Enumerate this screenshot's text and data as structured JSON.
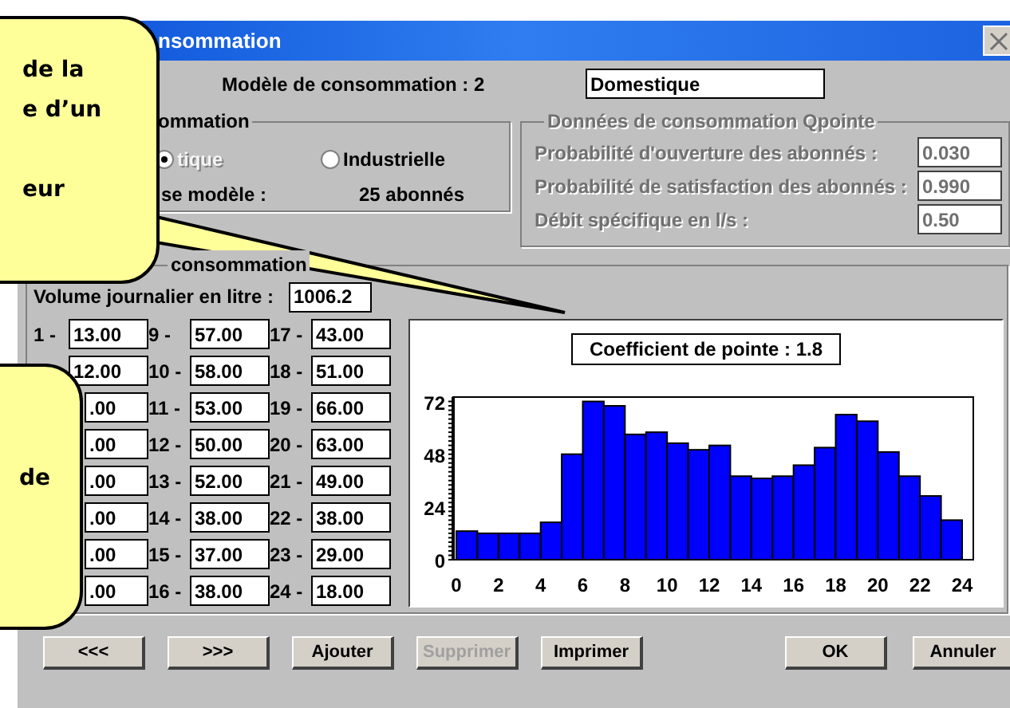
{
  "window": {
    "title": "nsommation"
  },
  "model": {
    "label": "Modèle de consommation : 2",
    "name": "Domestique"
  },
  "type_group": {
    "legend": "ommation",
    "options": [
      {
        "label": "tique",
        "selected": true,
        "disabled": true
      },
      {
        "label": "Industrielle",
        "selected": false,
        "disabled": false
      }
    ],
    "subscribers_label": "se modèle :",
    "subscribers_value": "25 abonnés"
  },
  "peak_group": {
    "legend": "Données de consommation Qpointe",
    "disabled": true,
    "fields": [
      {
        "label": "Probabilité d'ouverture des abonnés :",
        "value": "0.030"
      },
      {
        "label": "Probabilité de satisfaction des abonnés :",
        "value": "0.990"
      },
      {
        "label": "Débit spécifique en l/s :",
        "value": "0.50"
      }
    ]
  },
  "hourly_group": {
    "legend": "consommation",
    "volume_label": "Volume journalier en litre :",
    "volume": "1006.2",
    "hours": [
      {
        "label": "1 -",
        "value": "13.00"
      },
      {
        "value": "12.00"
      },
      {
        "value": ".00"
      },
      {
        "value": ".00"
      },
      {
        "value": ".00"
      },
      {
        "value": ".00"
      },
      {
        "value": ".00"
      },
      {
        "value": ".00"
      },
      {
        "label": "9 -",
        "value": "57.00"
      },
      {
        "label": "10 -",
        "value": "58.00"
      },
      {
        "label": "11 -",
        "value": "53.00"
      },
      {
        "label": "12 -",
        "value": "50.00"
      },
      {
        "label": "13 -",
        "value": "52.00"
      },
      {
        "label": "14 -",
        "value": "38.00"
      },
      {
        "label": "15 -",
        "value": "37.00"
      },
      {
        "label": "16 -",
        "value": "38.00"
      },
      {
        "label": "17 -",
        "value": "43.00"
      },
      {
        "label": "18 -",
        "value": "51.00"
      },
      {
        "label": "19 -",
        "value": "66.00"
      },
      {
        "label": "20 -",
        "value": "63.00"
      },
      {
        "label": "21 -",
        "value": "49.00"
      },
      {
        "label": "22 -",
        "value": "38.00"
      },
      {
        "label": "23 -",
        "value": "29.00"
      },
      {
        "label": "24 -",
        "value": "18.00"
      }
    ]
  },
  "chart": {
    "title": "Coefficient de pointe : 1.8",
    "chart_data": {
      "type": "bar",
      "x": [
        0.5,
        1.5,
        2.5,
        3.5,
        4.5,
        5.5,
        6.5,
        7.5,
        8.5,
        9.5,
        10.5,
        11.5,
        12.5,
        13.5,
        14.5,
        15.5,
        16.5,
        17.5,
        18.5,
        19.5,
        20.5,
        21.5,
        22.5,
        23.5
      ],
      "series": [
        {
          "color": "#0000ff",
          "values": [
            13,
            12,
            12,
            12,
            17,
            48,
            72,
            70,
            57,
            58,
            53,
            50,
            52,
            38,
            37,
            38,
            43,
            51,
            66,
            63,
            49,
            38,
            29,
            18
          ]
        }
      ],
      "xlim": [
        0,
        24
      ],
      "ylim": [
        0,
        74
      ],
      "xticks": [
        0,
        2,
        4,
        6,
        8,
        10,
        12,
        14,
        16,
        18,
        20,
        22,
        24
      ],
      "yticks": [
        0,
        24,
        48,
        72
      ]
    }
  },
  "buttons": [
    {
      "label": "<<<",
      "disabled": false
    },
    {
      "label": ">>>",
      "disabled": false
    },
    {
      "label": "Ajouter",
      "disabled": false
    },
    {
      "label": "Supprimer",
      "disabled": true
    },
    {
      "label": "Imprimer",
      "disabled": false
    },
    {
      "label": "OK",
      "disabled": false
    },
    {
      "label": "Annuler",
      "disabled": false
    }
  ],
  "callouts": [
    {
      "lines": [
        "de la",
        "e d’un",
        "eur"
      ]
    },
    {
      "lines": [
        "de"
      ]
    }
  ]
}
